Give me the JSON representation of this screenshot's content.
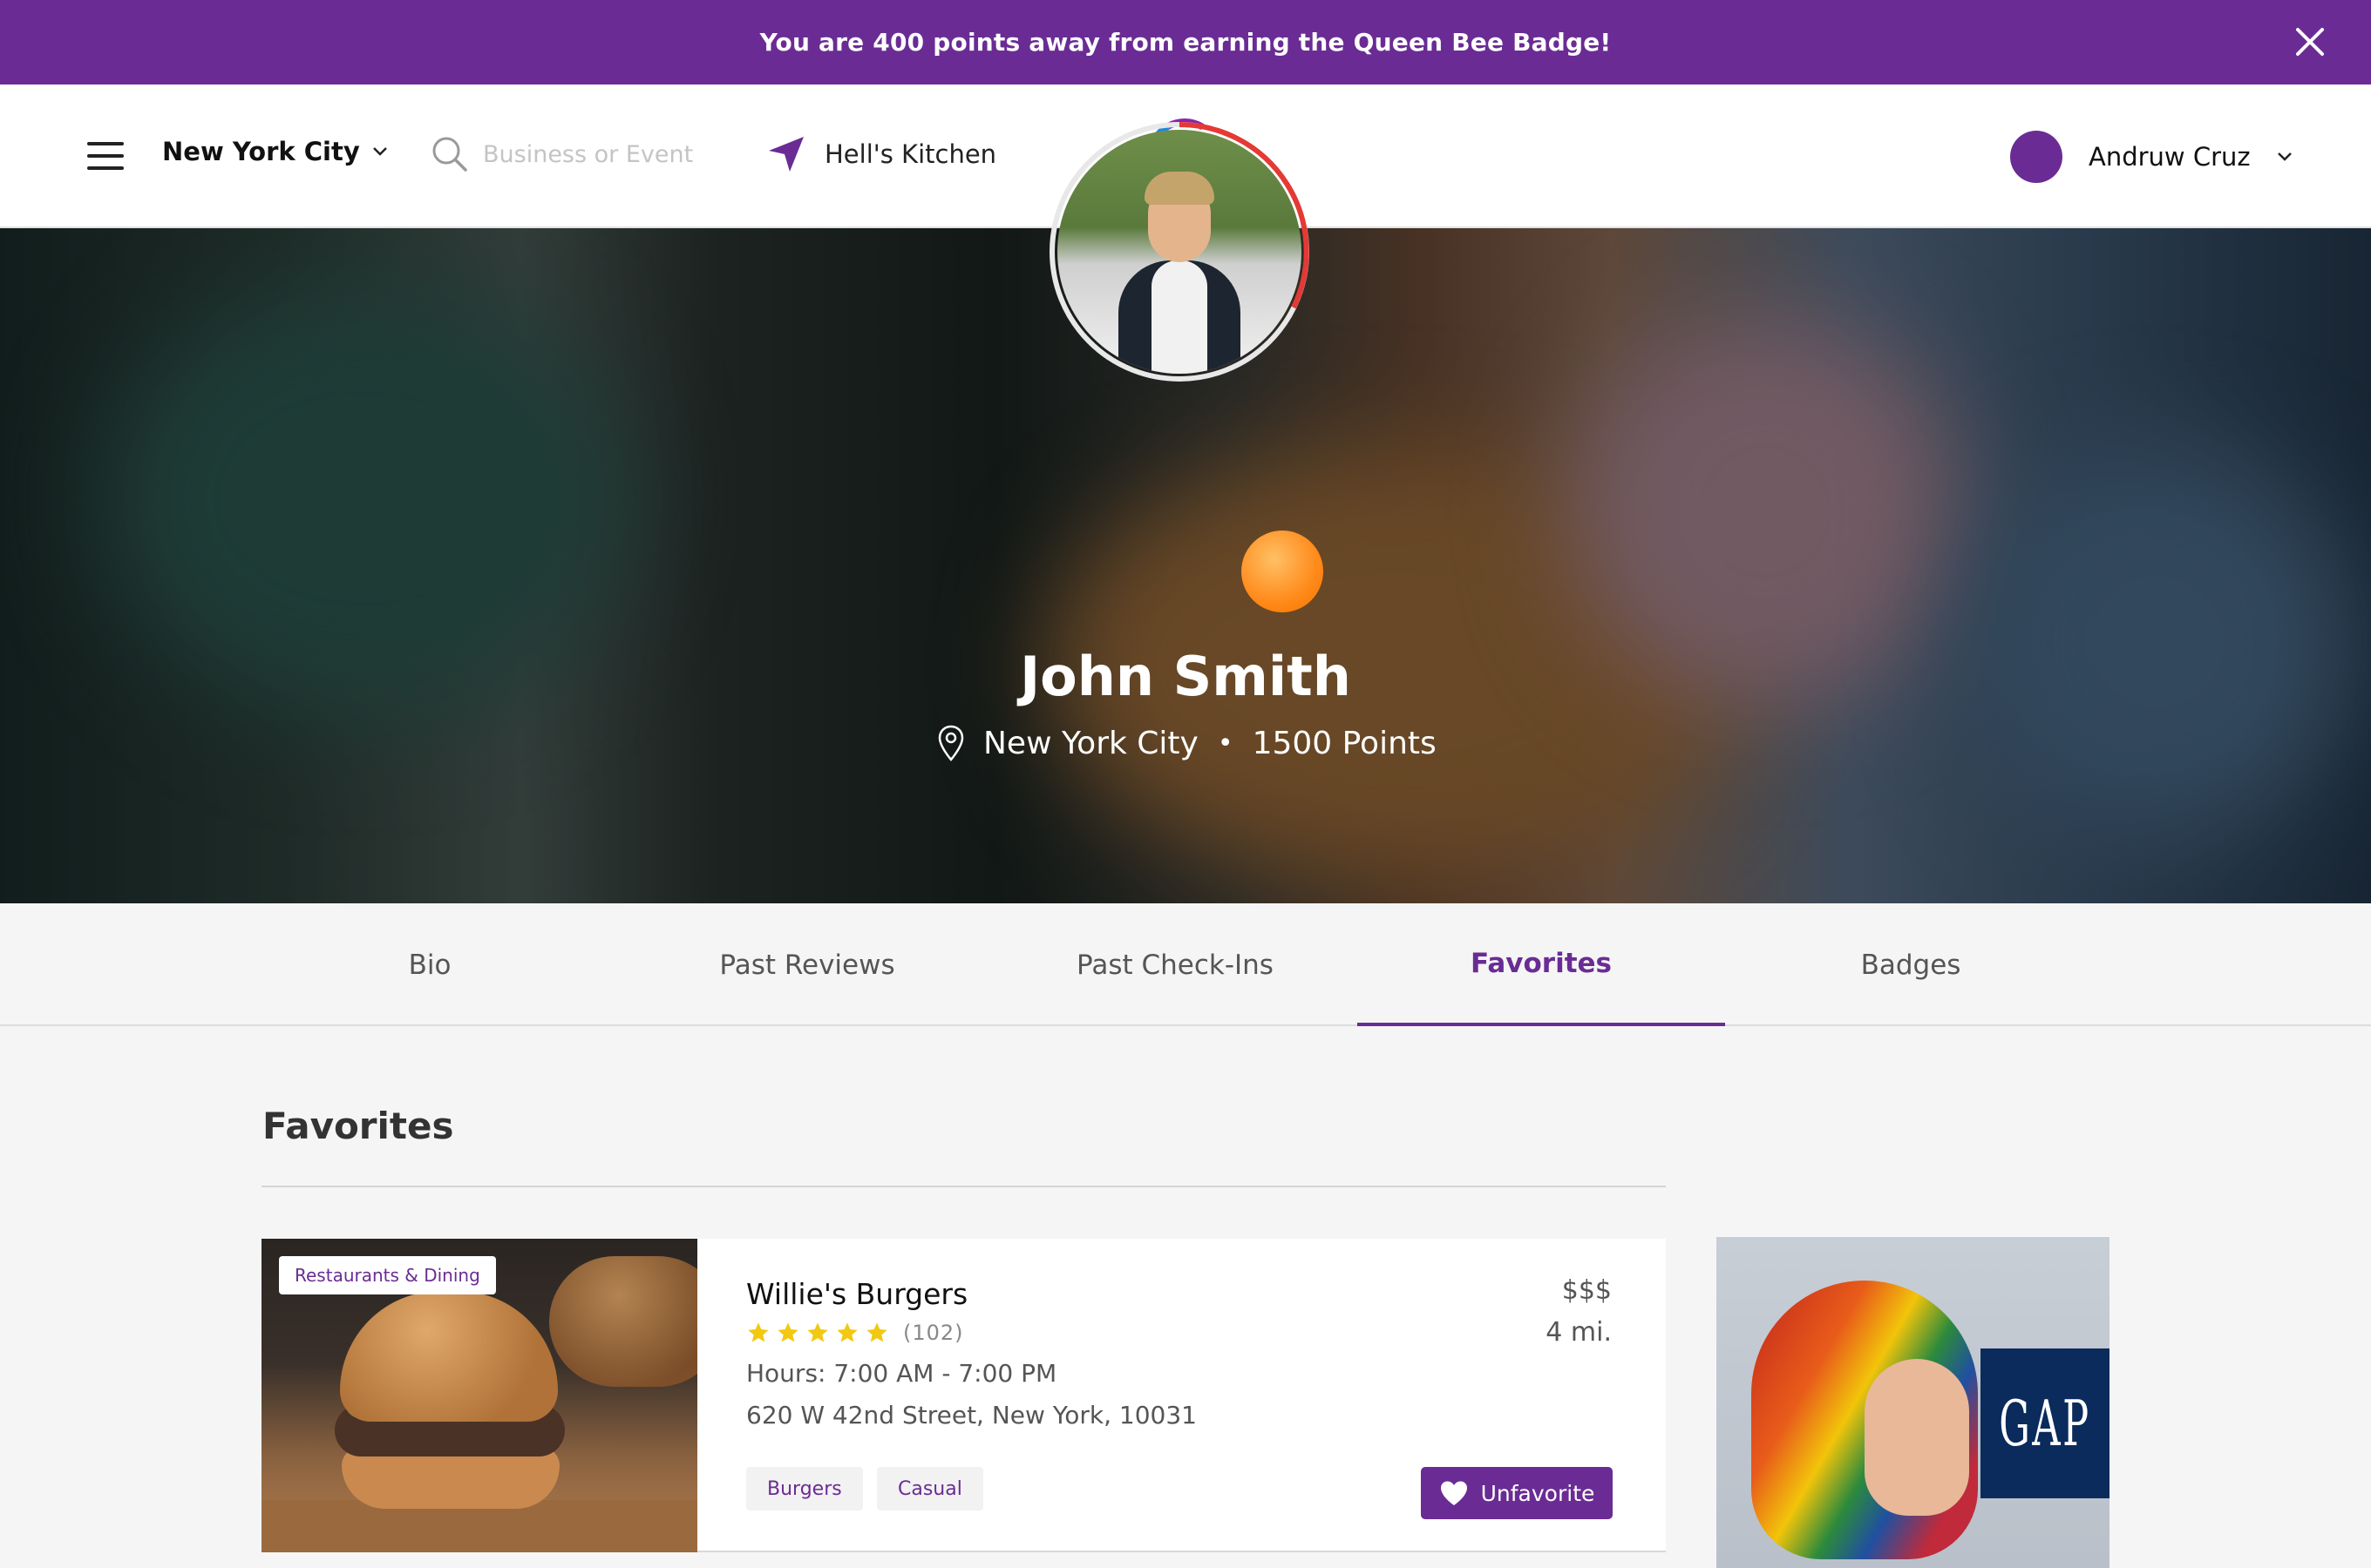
{
  "promo": {
    "text": "You are 400 points away from earning the Queen Bee Badge!"
  },
  "header": {
    "city": "New York City",
    "search_placeholder": "Business or Event",
    "location": "Hell's Kitchen",
    "user_name": "Andruw Cruz"
  },
  "profile": {
    "name": "John Smith",
    "city": "New York City",
    "separator": "•",
    "points": "1500 Points"
  },
  "tabs": [
    {
      "label": "Bio"
    },
    {
      "label": "Past Reviews"
    },
    {
      "label": "Past Check-Ins"
    },
    {
      "label": "Favorites",
      "active": true
    },
    {
      "label": "Badges"
    }
  ],
  "section": {
    "title": "Favorites"
  },
  "favorites": [
    {
      "category": "Restaurants & Dining",
      "name": "Willie's Burgers",
      "rating": 5,
      "review_count": "(102)",
      "hours": "Hours: 7:00 AM - 7:00 PM",
      "address": "620 W 42nd Street, New York, 10031",
      "price": "$$$",
      "distance": "4 mi.",
      "tags": [
        "Burgers",
        "Casual"
      ],
      "unfavorite_label": "Unfavorite"
    }
  ],
  "ad": {
    "brand_text": "GAP"
  },
  "colors": {
    "brand_purple": "#6a2c94",
    "star_yellow": "#f2c811",
    "badge_orange": "#ff8a1a",
    "ad_navy": "#0a2b5c"
  },
  "icons": [
    "close-icon",
    "menu-icon",
    "chevron-down-icon",
    "search-icon",
    "navigation-arrow-icon",
    "app-logo-icon",
    "map-pin-icon",
    "star-icon",
    "heart-icon"
  ]
}
